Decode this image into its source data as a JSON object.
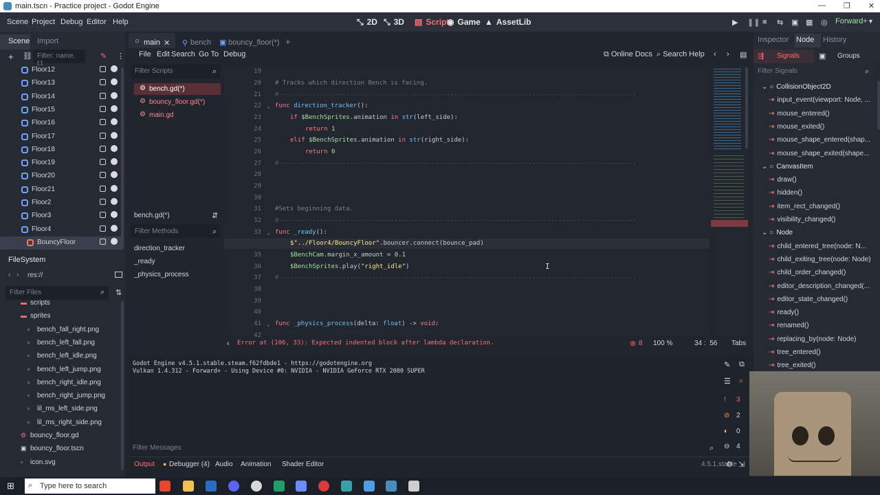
{
  "window": {
    "title": "main.tscn - Practice project - Godot Engine"
  },
  "menus": [
    "Scene",
    "Project",
    "Debug",
    "Editor",
    "Help"
  ],
  "workspaces": [
    {
      "label": "2D",
      "icon": "2d-icon"
    },
    {
      "label": "3D",
      "icon": "3d-icon"
    },
    {
      "label": "Script",
      "icon": "script-icon",
      "active": true
    },
    {
      "label": "Game",
      "icon": "game-icon"
    },
    {
      "label": "AssetLib",
      "icon": "assetlib-icon"
    }
  ],
  "renderer": "Forward+",
  "scene_dock": {
    "tabs": [
      "Scene",
      "Import"
    ],
    "filter_placeholder": "Filter: name, t:t",
    "items": [
      "Floor12",
      "Floor13",
      "Floor14",
      "Floor15",
      "Floor16",
      "Floor17",
      "Floor18",
      "Floor19",
      "Floor20",
      "Floor21",
      "Floor2",
      "Floor3",
      "Floor4",
      "BouncyFloor"
    ]
  },
  "filesystem": {
    "title": "FileSystem",
    "path": "res://",
    "filter_placeholder": "Filter Files",
    "items": [
      {
        "label": "scripts",
        "type": "folder"
      },
      {
        "label": "sprites",
        "type": "folder"
      },
      {
        "label": "bench_fall_right.png",
        "type": "image"
      },
      {
        "label": "bench_left_fall.png",
        "type": "image"
      },
      {
        "label": "bench_left_idle.png",
        "type": "image"
      },
      {
        "label": "bench_left_jump.png",
        "type": "image"
      },
      {
        "label": "bench_right_idle.png",
        "type": "image"
      },
      {
        "label": "bench_right_jump.png",
        "type": "image"
      },
      {
        "label": "lil_ms_left_side.png",
        "type": "image"
      },
      {
        "label": "lil_ms_right_side.png",
        "type": "image"
      },
      {
        "label": "bouncy_floor.gd",
        "type": "script"
      },
      {
        "label": "bouncy_floor.tscn",
        "type": "scene"
      },
      {
        "label": "icon.svg",
        "type": "image"
      }
    ]
  },
  "editor_tabs": [
    {
      "label": "main",
      "active": true
    },
    {
      "label": "bench"
    },
    {
      "label": "bouncy_floor(*)"
    }
  ],
  "script_menu": [
    "File",
    "Edit",
    "Search",
    "Go To",
    "Debug"
  ],
  "script_links": {
    "docs": "Online Docs",
    "search_help": "Search Help"
  },
  "scripts": {
    "filter_placeholder": "Filter Scripts",
    "items": [
      "bench.gd(*)",
      "bouncy_floor.gd(*)",
      "main.gd"
    ],
    "current": "bench.gd(*)"
  },
  "methods": {
    "filter_placeholder": "Filter Methods",
    "items": [
      "direction_tracker",
      "_ready",
      "_physics_process"
    ]
  },
  "code": {
    "line_numbers": [
      "19",
      "20",
      "21",
      "22",
      "23",
      "24",
      "25",
      "26",
      "27",
      "28",
      "29",
      "30",
      "31",
      "32",
      "33",
      "34",
      "35",
      "36",
      "37",
      "38",
      "39",
      "40",
      "41",
      "42"
    ],
    "lines": {
      "l20": "# Tracks which direction Bench is facing.",
      "l21": "#------------------------------------------------------------------------------------------------",
      "l22a": "func ",
      "l22b": "direction_tracker",
      "l22c": "():",
      "l23a": "if ",
      "l23b": "$BenchSprites",
      "l23c": ".animation ",
      "l23d": "in ",
      "l23e": "str",
      "l23f": "(left_side):",
      "l24a": "return ",
      "l24b": "1",
      "l25a": "elif ",
      "l25b": "$BenchSprites",
      "l25c": ".animation ",
      "l25d": "in ",
      "l25e": "str",
      "l25f": "(right_side):",
      "l26a": "return ",
      "l26b": "0",
      "l27": "#------------------------------------------------------------------------------------------------",
      "l31": "#Sets beginning data.",
      "l32": "#------------------------------------------------------------------------------------------------",
      "l33a": "func ",
      "l33b": "_ready",
      "l33c": "():",
      "l34a": "$\"../Floor4/BouncyFloor\"",
      "l34b": ".bouncer.connect(bounce_pad)",
      "l35a": "$BenchCam",
      "l35b": ".margin_x_amount = ",
      "l35c": "0.1",
      "l36a": "$BenchSprites",
      "l36b": ".play(",
      "l36c": "\"right_idle\"",
      "l36d": ")",
      "l37": "#------------------------------------------------------------------------------------------------",
      "l41a": "func ",
      "l41b": "_physics_process",
      "l41c": "(delta: ",
      "l41d": "float",
      "l41e": ") -> ",
      "l41f": "void",
      "l41g": ":"
    }
  },
  "status": {
    "error": "Error at (106, 33): Expected indented block after lambda declaration.",
    "error_count": "8",
    "zoom": "100 %",
    "position": "34 :  56",
    "indent": "Tabs"
  },
  "output": {
    "lines": [
      "Godot Engine v4.5.1.stable.steam.f62fdbde1 - https://godotengine.org",
      "Vulkan 1.4.312 - Forward+ - Using Device #0: NVIDIA - NVIDIA GeForce RTX 2080 SUPER"
    ],
    "filter_placeholder": "Filter Messages",
    "counts": {
      "errors": "3",
      "warnings": "2",
      "info": "0",
      "messages": "4"
    }
  },
  "bottom_tabs": [
    "Output",
    "Debugger (4)",
    "Audio",
    "Animation",
    "Shader Editor"
  ],
  "version": "4.5.1.stable",
  "right_dock": {
    "tabs": [
      "Inspector",
      "Node",
      "History"
    ],
    "subtabs": [
      "Signals",
      "Groups"
    ],
    "filter_placeholder": "Filter Signals",
    "signals": [
      {
        "label": "CollisionObject2D",
        "cls": true
      },
      {
        "label": "input_event(viewport: Node, ..."
      },
      {
        "label": "mouse_entered()"
      },
      {
        "label": "mouse_exited()"
      },
      {
        "label": "mouse_shape_entered(shap..."
      },
      {
        "label": "mouse_shape_exited(shape..."
      },
      {
        "label": "CanvasItem",
        "cls": true
      },
      {
        "label": "draw()"
      },
      {
        "label": "hidden()"
      },
      {
        "label": "item_rect_changed()"
      },
      {
        "label": "visibility_changed()"
      },
      {
        "label": "Node",
        "cls": true
      },
      {
        "label": "child_entered_tree(node: N..."
      },
      {
        "label": "child_exiting_tree(node: Node)"
      },
      {
        "label": "child_order_changed()"
      },
      {
        "label": "editor_description_changed(..."
      },
      {
        "label": "editor_state_changed()"
      },
      {
        "label": "ready()"
      },
      {
        "label": "renamed()"
      },
      {
        "label": "replacing_by(node: Node)"
      },
      {
        "label": "tree_entered()"
      },
      {
        "label": "tree_exited()"
      }
    ]
  },
  "taskbar": {
    "search_placeholder": "Type here to search"
  }
}
